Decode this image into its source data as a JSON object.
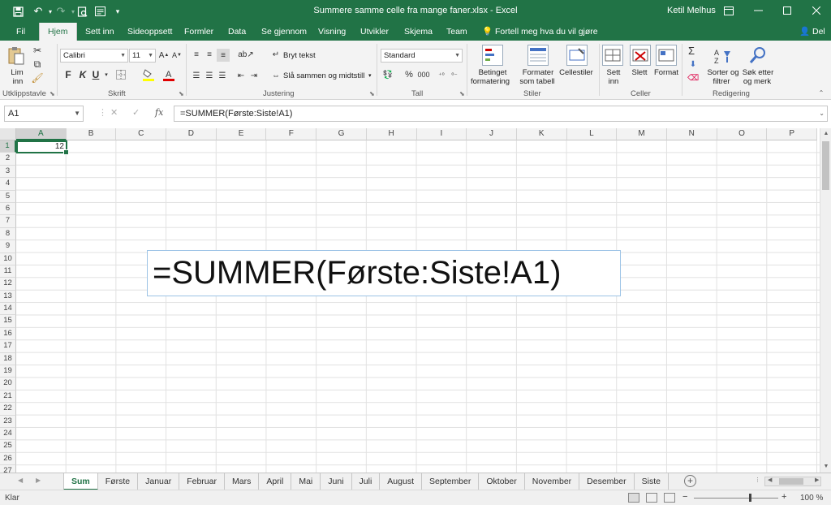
{
  "titlebar": {
    "title": "Summere samme celle fra mange faner.xlsx - Excel",
    "user": "Ketil Melhus",
    "qat_icons": [
      "save-icon",
      "undo-icon",
      "redo-icon",
      "print-preview-icon",
      "form-icon",
      "customize-qat-icon"
    ],
    "window_buttons": [
      "ribbon-display-icon",
      "minimize-icon",
      "maximize-icon",
      "close-icon"
    ]
  },
  "tabs": [
    {
      "label": "Fil"
    },
    {
      "label": "Hjem"
    },
    {
      "label": "Sett inn"
    },
    {
      "label": "Sideoppsett"
    },
    {
      "label": "Formler"
    },
    {
      "label": "Data"
    },
    {
      "label": "Se gjennom"
    },
    {
      "label": "Visning"
    },
    {
      "label": "Utvikler"
    },
    {
      "label": "Skjema"
    },
    {
      "label": "Team"
    }
  ],
  "active_tab": "Hjem",
  "tell_me": "Fortell meg hva du vil gjøre",
  "share": "Del",
  "ribbon": {
    "clipboard": {
      "label": "Utklippstavle",
      "paste_line1": "Lim",
      "paste_line2": "inn"
    },
    "font": {
      "label": "Skrift",
      "font_name": "Calibri",
      "font_size": "11",
      "bold": "F",
      "italic": "K",
      "underline": "U"
    },
    "alignment": {
      "label": "Justering",
      "wrap_text": "Bryt tekst",
      "merge_center": "Slå sammen og midtstill"
    },
    "number": {
      "label": "Tall",
      "format": "Standard",
      "percent": "%",
      "comma": "000"
    },
    "styles": {
      "label": "Stiler",
      "conditional_line1": "Betinget",
      "conditional_line2": "formatering",
      "table_line1": "Formater",
      "table_line2": "som tabell",
      "cellstyles_line1": "Cellestiler"
    },
    "cells": {
      "label": "Celler",
      "insert_line1": "Sett",
      "insert_line2": "inn",
      "delete_line1": "Slett",
      "format_line1": "Format"
    },
    "editing": {
      "label": "Redigering",
      "sort_line1": "Sorter og",
      "sort_line2": "filtrer",
      "find_line1": "Søk etter",
      "find_line2": "og merk"
    }
  },
  "formula_bar": {
    "name_box": "A1",
    "cancel": "✕",
    "enter": "✓",
    "fx": "fx",
    "formula": "=SUMMER(Første:Siste!A1)"
  },
  "grid": {
    "columns": [
      "A",
      "B",
      "C",
      "D",
      "E",
      "F",
      "G",
      "H",
      "I",
      "J",
      "K",
      "L",
      "M",
      "N",
      "O",
      "P"
    ],
    "rows": [
      "1",
      "2",
      "3",
      "4",
      "5",
      "6",
      "7",
      "8",
      "9",
      "10",
      "11",
      "12",
      "13",
      "14",
      "15",
      "16",
      "17",
      "18",
      "19",
      "20",
      "21",
      "22",
      "23",
      "24",
      "25",
      "26",
      "27"
    ],
    "selected_cell": "A1",
    "a1_value": "12"
  },
  "callout": {
    "text": "=SUMMER(Første:Siste!A1)"
  },
  "sheets": [
    "Sum",
    "Første",
    "Januar",
    "Februar",
    "Mars",
    "April",
    "Mai",
    "Juni",
    "Juli",
    "August",
    "September",
    "Oktober",
    "November",
    "Desember",
    "Siste"
  ],
  "active_sheet": "Sum",
  "status": {
    "ready": "Klar",
    "zoom": "100 %"
  },
  "colors": {
    "accent": "#217346",
    "callout_border": "#9cc3e6"
  }
}
